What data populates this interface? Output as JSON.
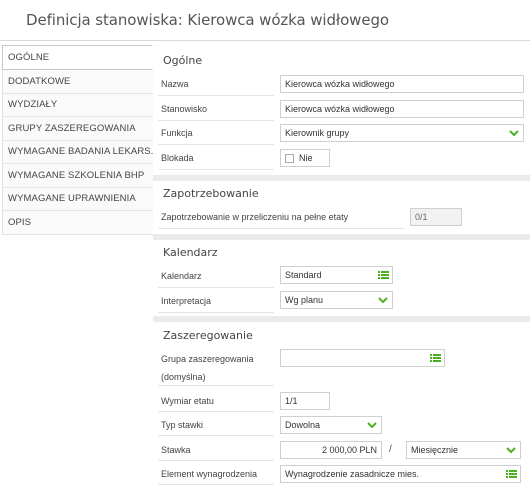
{
  "window": {
    "title": "Definicja stanowiska: Kierowca wózka widłowego"
  },
  "sidebar": {
    "items": [
      {
        "label": "OGÓLNE"
      },
      {
        "label": "DODATKOWE"
      },
      {
        "label": "WYDZIAŁY"
      },
      {
        "label": "GRUPY ZASZEREGOWANIA"
      },
      {
        "label": "WYMAGANE BADANIA LEKARS..."
      },
      {
        "label": "WYMAGANE SZKOLENIA BHP"
      },
      {
        "label": "WYMAGANE UPRAWNIENIA"
      },
      {
        "label": "OPIS"
      }
    ]
  },
  "general": {
    "title": "Ogólne",
    "name_label": "Nazwa",
    "name_value": "Kierowca wózka widłowego",
    "position_label": "Stanowisko",
    "position_value": "Kierowca wózka widłowego",
    "function_label": "Funkcja",
    "function_value": "Kierownik grupy",
    "block_label": "Blokada",
    "block_value": "Nie"
  },
  "demand": {
    "title": "Zapotrzebowanie",
    "fte_label": "Zapotrzebowanie w przeliczeniu na pełne etaty",
    "fte_value": "0/1"
  },
  "calendar": {
    "title": "Kalendarz",
    "calendar_label": "Kalendarz",
    "calendar_value": "Standard",
    "interpretation_label": "Interpretacja",
    "interpretation_value": "Wg planu"
  },
  "grading": {
    "title": "Zaszeregowanie",
    "group_label_1": "Grupa zaszeregowania",
    "group_label_2": "(domyślna)",
    "group_value": "",
    "fte_dim_label": "Wymiar etatu",
    "fte_dim_value": "1/1",
    "rate_type_label": "Typ stawki",
    "rate_type_value": "Dowolna",
    "rate_label": "Stawka",
    "rate_value": "2 000,00 PLN",
    "rate_separator": "/",
    "rate_period_value": "Miesięcznie",
    "pay_element_label": "Element wynagrodzenia",
    "pay_element_value": "Wynagrodzenie zasadnicze mies."
  },
  "colors": {
    "accent_green": "#4caf1f",
    "divider": "#ebebeb",
    "border": "#cfcfcf"
  }
}
